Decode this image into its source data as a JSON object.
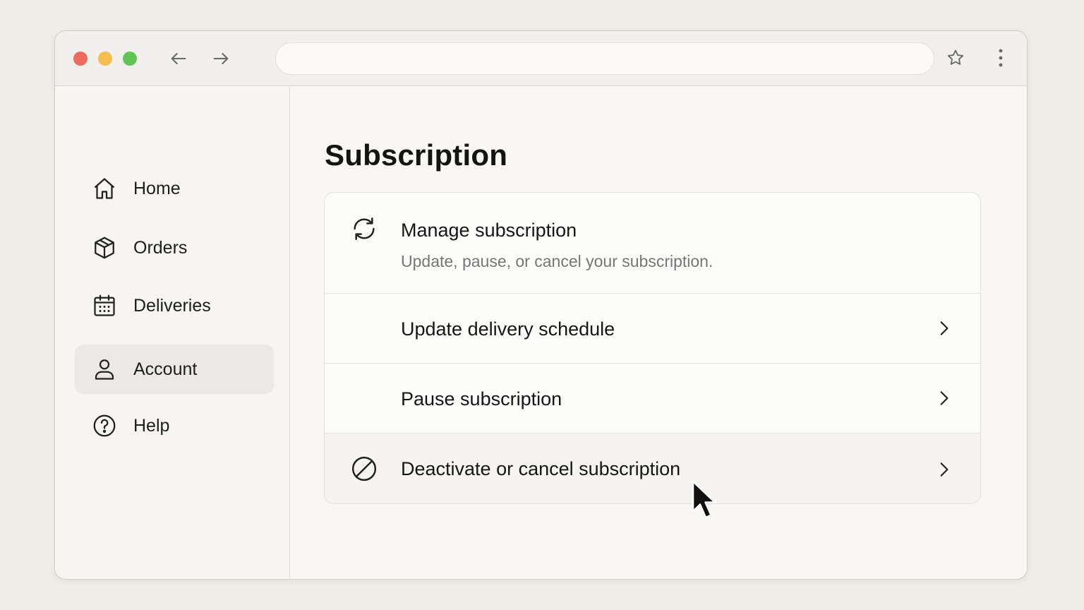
{
  "browser": {
    "address_text": "",
    "icons": {
      "back": "arrow-left-icon",
      "forward": "arrow-right-icon",
      "bookmark": "star-icon",
      "menu": "vertical-dots-icon"
    },
    "traffic_lights": {
      "close": "#ec6a5e",
      "minimize": "#f4bf4f",
      "zoom": "#61c554"
    }
  },
  "sidebar": {
    "items": [
      {
        "label": "Home",
        "icon": "home-icon",
        "active": false
      },
      {
        "label": "Orders",
        "icon": "package-icon",
        "active": false
      },
      {
        "label": "Deliveries",
        "icon": "calendar-icon",
        "active": false
      },
      {
        "label": "Account",
        "icon": "user-icon",
        "active": true
      },
      {
        "label": "Help",
        "icon": "help-circle-icon",
        "active": false
      }
    ]
  },
  "main": {
    "title": "Subscription",
    "options": [
      {
        "title": "Manage subscription",
        "subtitle": "Update, pause, or cancel your subscription.",
        "icon": "refresh-icon"
      },
      {
        "title": "Update delivery schedule",
        "icon": "chevron-right-icon"
      },
      {
        "title": "Pause subscription",
        "icon": "chevron-right-icon"
      },
      {
        "title": "Deactivate or cancel subscription",
        "icon": "ban-icon",
        "hovered": true
      }
    ]
  },
  "pointer": {
    "icon": "mouse-pointer-icon"
  }
}
